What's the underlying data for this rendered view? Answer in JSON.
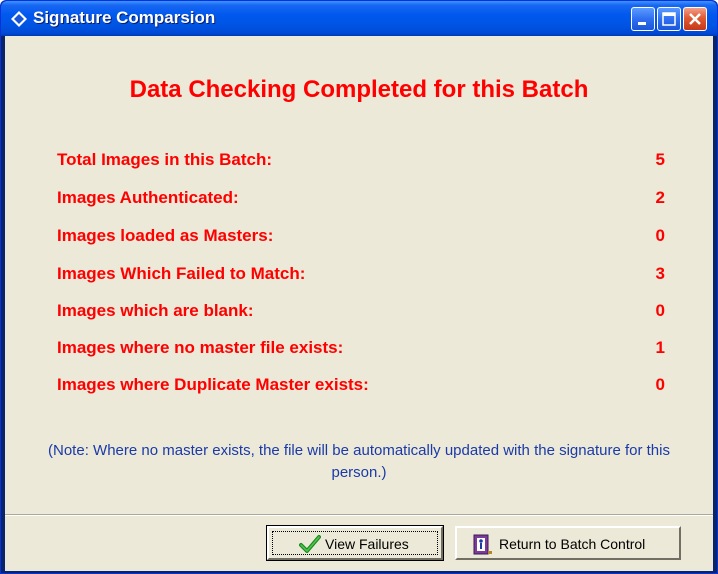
{
  "window": {
    "title": "Signature Comparsion"
  },
  "heading": "Data Checking Completed for this Batch",
  "stats": [
    {
      "label": "Total Images in this Batch:",
      "value": "5"
    },
    {
      "label": "Images Authenticated:",
      "value": "2"
    },
    {
      "label": "Images loaded as Masters:",
      "value": "0"
    },
    {
      "label": "Images Which Failed to Match:",
      "value": "3"
    },
    {
      "label": "Images which are blank:",
      "value": "0"
    },
    {
      "label": "Images where no master file exists:",
      "value": "1"
    },
    {
      "label": "Images where Duplicate Master exists:",
      "value": "0"
    }
  ],
  "note": "(Note:  Where no master exists, the file will be automatically updated with the signature for this person.)",
  "buttons": {
    "view_failures": {
      "label": "View Failures",
      "icon": "checkmark-icon"
    },
    "return_batch": {
      "label": "Return to Batch Control",
      "icon": "door-exit-icon"
    }
  },
  "colors": {
    "text_red": "#ff0000",
    "note_blue": "#1a3aa8",
    "dialog_bg": "#ece9d8",
    "titlebar_blue": "#0054e3"
  }
}
